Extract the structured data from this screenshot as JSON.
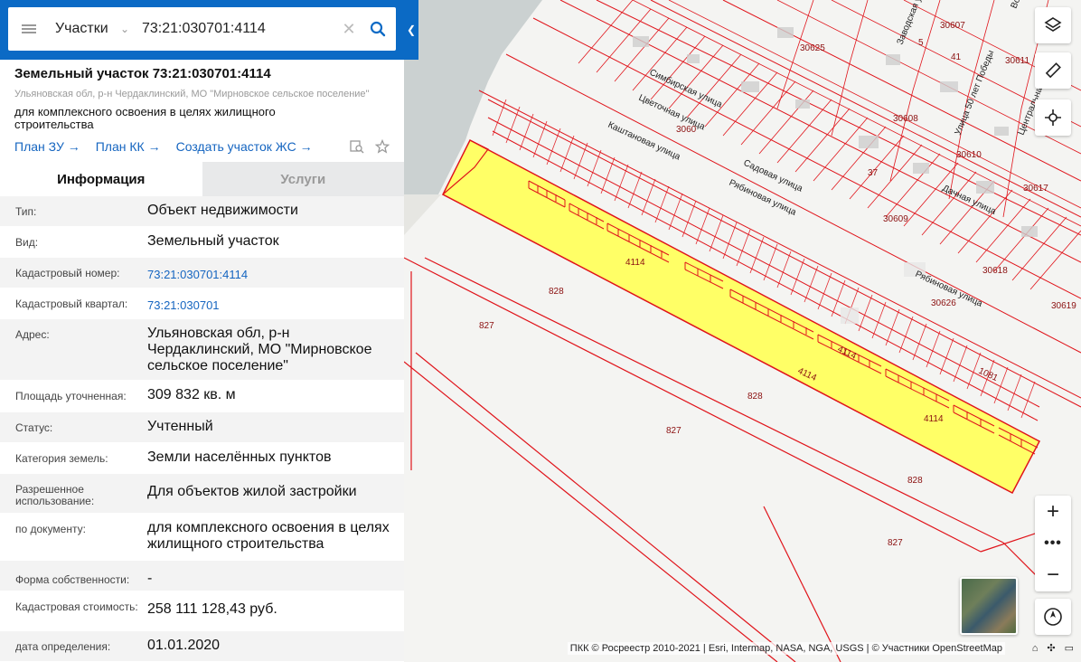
{
  "search": {
    "layer": "Участки",
    "query": "73:21:030701:4114"
  },
  "parcel": {
    "title": "Земельный участок 73:21:030701:4114",
    "address_sub": "Ульяновская обл, р-н Чердаклинский, МО \"Мирновское сельское поселение\"",
    "purpose": "для комплексного освоения в целях жилищного строительства",
    "links": [
      "План ЗУ",
      "План КК",
      "Создать участок ЖС"
    ]
  },
  "tabs": [
    "Информация",
    "Услуги"
  ],
  "properties": [
    {
      "key": "Тип:",
      "value": "Объект недвижимости"
    },
    {
      "key": "Вид:",
      "value": "Земельный участок"
    },
    {
      "key": "Кадастровый номер:",
      "value": "73:21:030701:4114"
    },
    {
      "key": "Кадастровый квартал:",
      "value": "73:21:030701"
    },
    {
      "key": "Адрес:",
      "value": "Ульяновская обл, р-н Чердаклинский, МО \"Мирновское сельское поселение\""
    },
    {
      "key": "Площадь уточненная:",
      "value": "309 832 кв. м"
    },
    {
      "key": "Статус:",
      "value": "Учтенный"
    },
    {
      "key": "Категория земель:",
      "value": "Земли населённых пунктов"
    },
    {
      "key": "Разрешенное использование:",
      "value": "Для объектов жилой застройки"
    },
    {
      "key": "по документу:",
      "value": "для комплексного освоения в целях жилищного строительства"
    },
    {
      "key": "Форма собственности:",
      "value": "-"
    },
    {
      "key": "Кадастровая стоимость:",
      "value": "258 111 128,43 руб."
    },
    {
      "key": "дата определения:",
      "value": "01.01.2020"
    }
  ],
  "map": {
    "parcel_labels": [
      "4114",
      "4114",
      "4114",
      "4114",
      "828",
      "828",
      "828",
      "827",
      "827",
      "827",
      "1081"
    ],
    "quarter_labels": [
      "30625",
      "30607",
      "30611",
      "30608",
      "30610",
      "30617",
      "30609",
      "30618",
      "30626",
      "30619",
      "3060",
      "5",
      "41",
      "37"
    ],
    "streets": [
      "Симбирская улица",
      "Цветочная улица",
      "Каштановая улица",
      "Садовая улица",
      "Рябиновая улица",
      "Дачная улица",
      "Рябиновая улица",
      "Улица 50 лет Победы",
      "Заводская ул.",
      "Центральная",
      "Вол"
    ],
    "attribution": "ПКК © Росреестр 2010-2021 | Esri, Intermap, NASA, NGA, USGS | © Участники OpenStreetMap",
    "highlight_color": "#ffff66",
    "boundary_color": "#e0141b"
  }
}
